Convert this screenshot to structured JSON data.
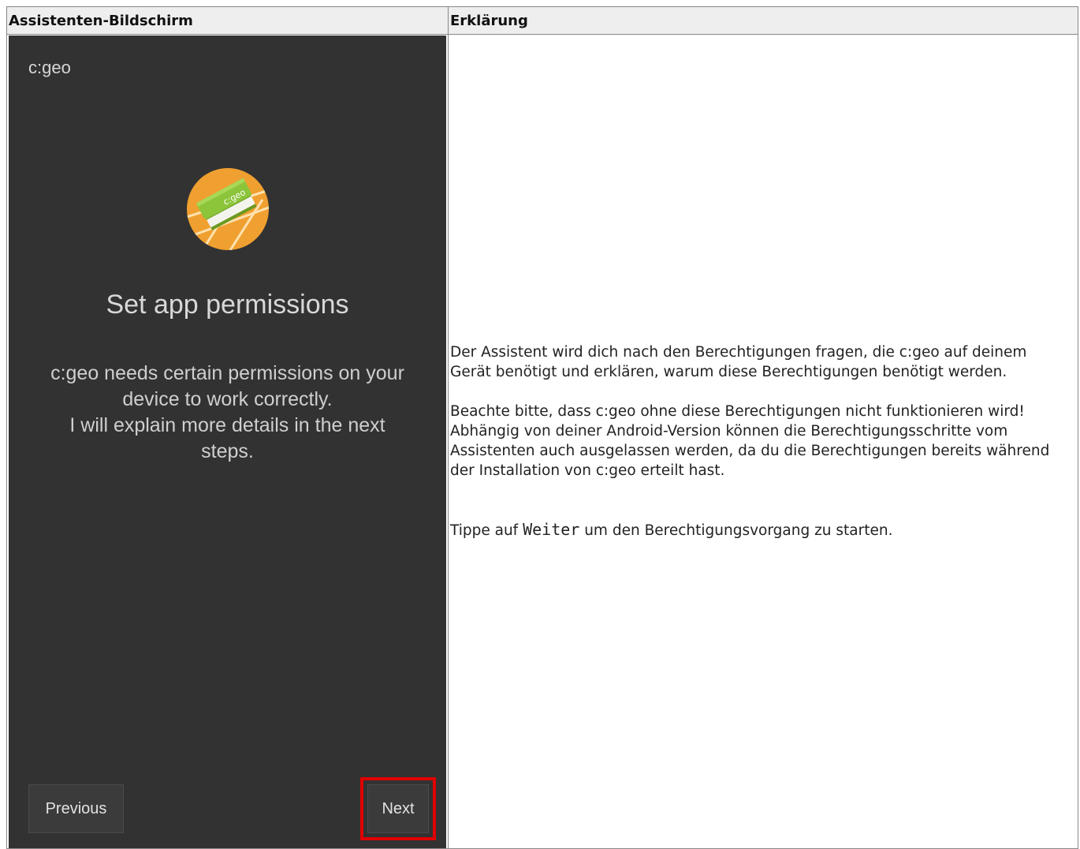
{
  "table": {
    "header_screen": "Assistenten-Bildschirm",
    "header_explanation": "Erklärung"
  },
  "screen": {
    "app_title": "c:geo",
    "logo_text": "c:geo",
    "title": "Set app permissions",
    "body_lines": [
      "c:geo needs certain permissions on your",
      "device to work correctly.",
      "I will explain more details in the next",
      "steps."
    ],
    "previous_label": "Previous",
    "next_label": "Next",
    "highlight_color": "#e00000",
    "background_color": "#323232"
  },
  "explanation": {
    "p1": "Der Assistent wird dich nach den Berechtigungen fragen, die c:geo auf deinem Gerät benötigt und erklären, warum diese Berechtigungen benötigt werden.",
    "p2_a": "Beachte bitte, dass c:geo ohne diese Berechtigungen nicht funktionieren wird!",
    "p2_b": "Abhängig von deiner Android-Version können die Berechtigungsschritte vom Assistenten auch ausgelassen werden, da du die Berechtigungen bereits während der Installation von c:geo erteilt hast.",
    "p3_before": "Tippe auf ",
    "p3_code": "Weiter",
    "p3_after": " um den Berechtigungsvorgang zu starten."
  }
}
